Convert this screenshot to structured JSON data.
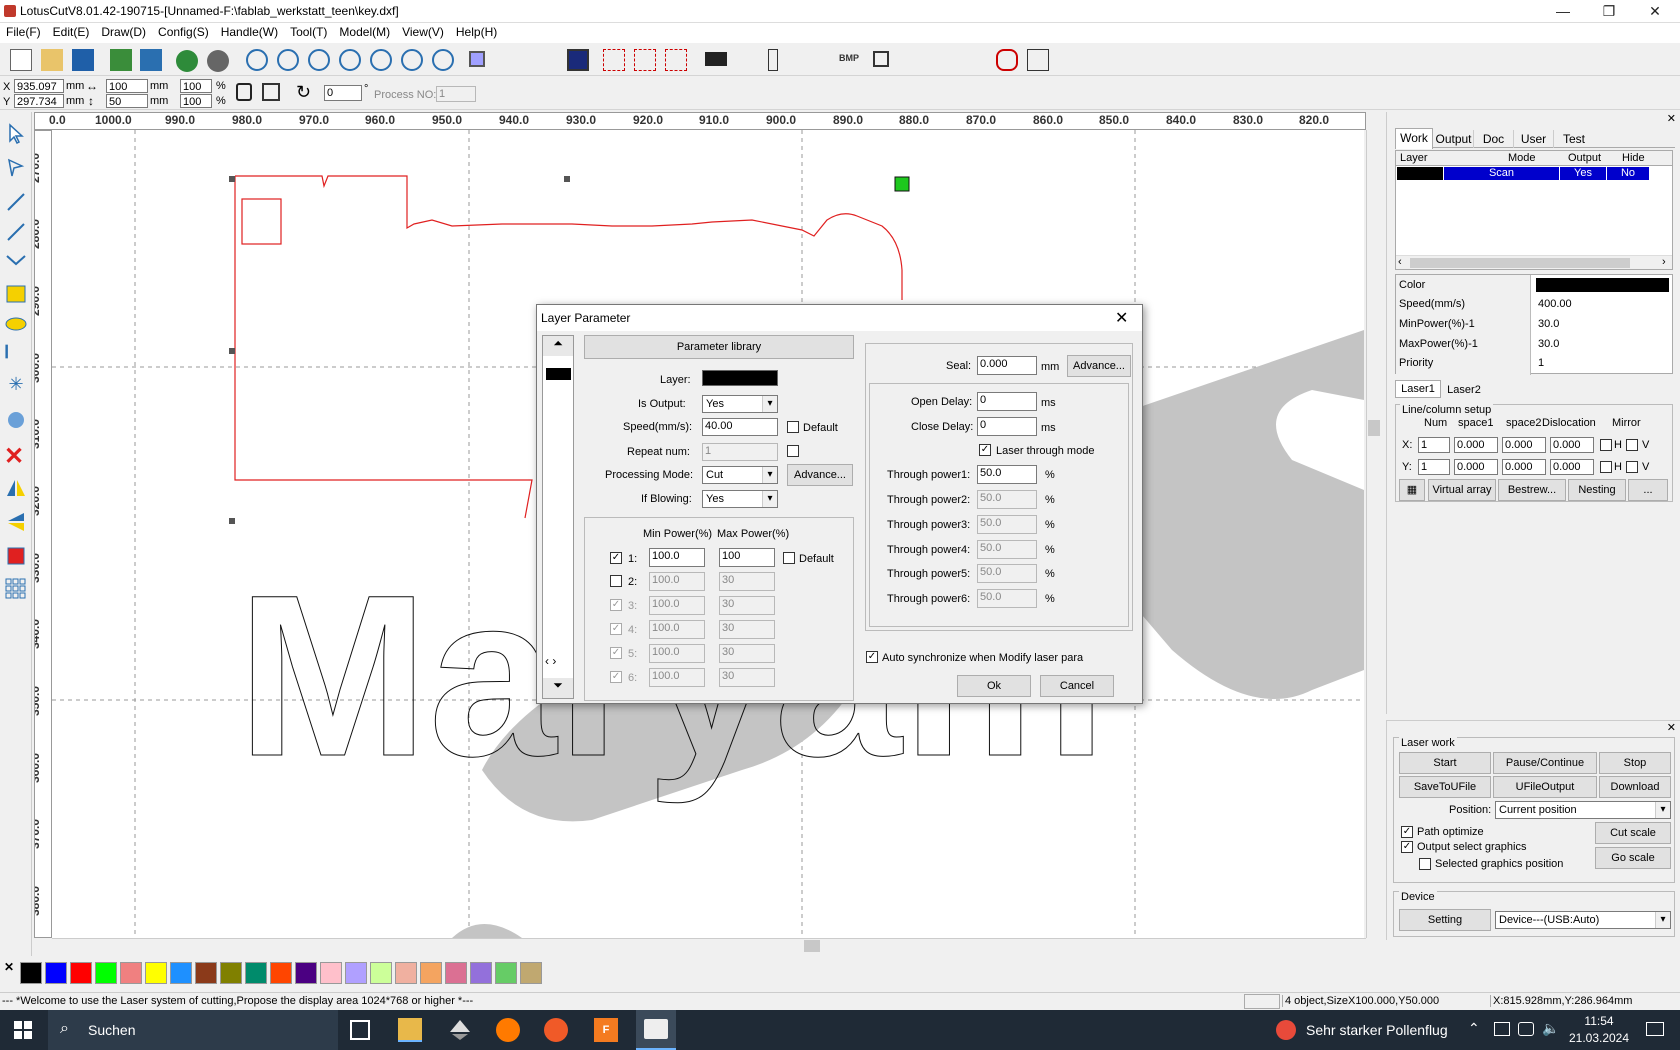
{
  "window": {
    "title": "LotusCutV8.01.42-190715-[Unnamed-F:\\fablab_werkstatt_teen\\key.dxf]",
    "minimize": "—",
    "restore": "❐",
    "close": "✕"
  },
  "menu": [
    "File(F)",
    "Edit(E)",
    "Draw(D)",
    "Config(S)",
    "Handle(W)",
    "Tool(T)",
    "Model(M)",
    "View(V)",
    "Help(H)"
  ],
  "toolbar2": {
    "x_label": "X",
    "x_value": "935.097",
    "x_unit": "mm",
    "y_label": "Y",
    "y_value": "297.734",
    "y_unit": "mm",
    "width_value": "100",
    "width_unit": "mm",
    "height_value": "50",
    "height_unit": "mm",
    "scale_w": "100",
    "scale_h": "100",
    "pct": "%",
    "rotate_value": "0",
    "deg": "°",
    "process_no_label": "Process NO:",
    "process_no_value": "1"
  },
  "ruler_h": [
    "0.0",
    "1000.0",
    "990.0",
    "980.0",
    "970.0",
    "960.0",
    "950.0",
    "940.0",
    "930.0",
    "920.0",
    "910.0",
    "900.0",
    "890.0",
    "880.0",
    "870.0",
    "860.0",
    "850.0",
    "840.0",
    "830.0",
    "820.0"
  ],
  "ruler_v": [
    "270.0",
    "280.0",
    "290.0",
    "300.0",
    "310.0",
    "320.0",
    "330.0",
    "340.0",
    "350.0",
    "360.0",
    "370.0",
    "380.0"
  ],
  "canvas_text": "Maryam",
  "right_panel": {
    "tabs": [
      "Work",
      "Output",
      "Doc",
      "User",
      "Test"
    ],
    "layer_headers": [
      "Layer",
      "Mode",
      "Output",
      "Hide"
    ],
    "layer_row": {
      "mode": "Scan",
      "output": "Yes",
      "hide": "No"
    },
    "props": [
      {
        "name": "Color",
        "value": ""
      },
      {
        "name": "Speed(mm/s)",
        "value": "400.00"
      },
      {
        "name": "MinPower(%)-1",
        "value": "30.0"
      },
      {
        "name": "MaxPower(%)-1",
        "value": "30.0"
      },
      {
        "name": "Priority",
        "value": "1"
      }
    ],
    "laser_tabs": [
      "Laser1",
      "Laser2"
    ],
    "linecol_title": "Line/column setup",
    "linecol_headers": [
      "Num",
      "space1",
      "space2",
      "Dislocation",
      "Mirror"
    ],
    "x_row": {
      "label": "X:",
      "num": "1",
      "s1": "0.000",
      "s2": "0.000",
      "dis": "0.000"
    },
    "y_row": {
      "label": "Y:",
      "num": "1",
      "s1": "0.000",
      "s2": "0.000",
      "dis": "0.000"
    },
    "mirror_h": "H",
    "mirror_v": "V",
    "buttons": [
      "Virtual array",
      "Bestrew...",
      "Nesting",
      "..."
    ]
  },
  "laser_work": {
    "title": "Laser work",
    "start": "Start",
    "pause": "Pause/Continue",
    "stop": "Stop",
    "save_u": "SaveToUFile",
    "ufile": "UFileOutput",
    "download": "Download",
    "position_label": "Position:",
    "position_value": "Current position",
    "path_optimize": "Path optimize",
    "output_select": "Output select graphics",
    "selected_pos": "Selected graphics position",
    "cut_scale": "Cut scale",
    "go_scale": "Go scale",
    "device_title": "Device",
    "setting": "Setting",
    "device_value": "Device---(USB:Auto)"
  },
  "dialog": {
    "title": "Layer Parameter",
    "param_library": "Parameter library",
    "layer_label": "Layer:",
    "is_output_label": "Is Output:",
    "is_output_value": "Yes",
    "speed_label": "Speed(mm/s):",
    "speed_value": "40.00",
    "default_label": "Default",
    "repeat_label": "Repeat num:",
    "repeat_value": "1",
    "mode_label": "Processing Mode:",
    "mode_value": "Cut",
    "advance_label": "Advance...",
    "blowing_label": "If Blowing:",
    "blowing_value": "Yes",
    "min_power_hdr": "Min Power(%)",
    "max_power_hdr": "Max Power(%)",
    "powers": [
      {
        "n": "1:",
        "min": "100.0",
        "max": "100"
      },
      {
        "n": "2:",
        "min": "100.0",
        "max": "30"
      },
      {
        "n": "3:",
        "min": "100.0",
        "max": "30"
      },
      {
        "n": "4:",
        "min": "100.0",
        "max": "30"
      },
      {
        "n": "5:",
        "min": "100.0",
        "max": "30"
      },
      {
        "n": "6:",
        "min": "100.0",
        "max": "30"
      }
    ],
    "seal_label": "Seal:",
    "seal_value": "0.000",
    "mm": "mm",
    "seal_advance": "Advance...",
    "open_delay_label": "Open Delay:",
    "open_delay_value": "0",
    "close_delay_label": "Close Delay:",
    "close_delay_value": "0",
    "ms": "ms",
    "laser_through": "Laser through mode",
    "through": [
      {
        "label": "Through power1:",
        "value": "50.0"
      },
      {
        "label": "Through power2:",
        "value": "50.0"
      },
      {
        "label": "Through power3:",
        "value": "50.0"
      },
      {
        "label": "Through power4:",
        "value": "50.0"
      },
      {
        "label": "Through power5:",
        "value": "50.0"
      },
      {
        "label": "Through power6:",
        "value": "50.0"
      }
    ],
    "auto_sync": "Auto synchronize when Modify laser para",
    "ok": "Ok",
    "cancel": "Cancel"
  },
  "palette": [
    "#000000",
    "#0000ff",
    "#ff0000",
    "#00ff00",
    "#f08080",
    "#ffff00",
    "#1e90ff",
    "#8b3a1a",
    "#808000",
    "#008b6b",
    "#ff4500",
    "#4b0082",
    "#ffc0cb",
    "#b0a0ff",
    "#ccff99",
    "#f0b0a0",
    "#f4a460",
    "#db7093",
    "#9370db",
    "#66cc66",
    "#c0a870"
  ],
  "status": {
    "welcome": "--- *Welcome to use the Laser system of cutting,Propose the display area 1024*768 or higher *---",
    "objects": "4 object,SizeX100.000,Y50.000",
    "coords": "X:815.928mm,Y:286.964mm"
  },
  "taskbar": {
    "search": "Suchen",
    "weather": "Sehr starker Pollenflug",
    "time": "11:54",
    "date": "21.03.2024"
  }
}
